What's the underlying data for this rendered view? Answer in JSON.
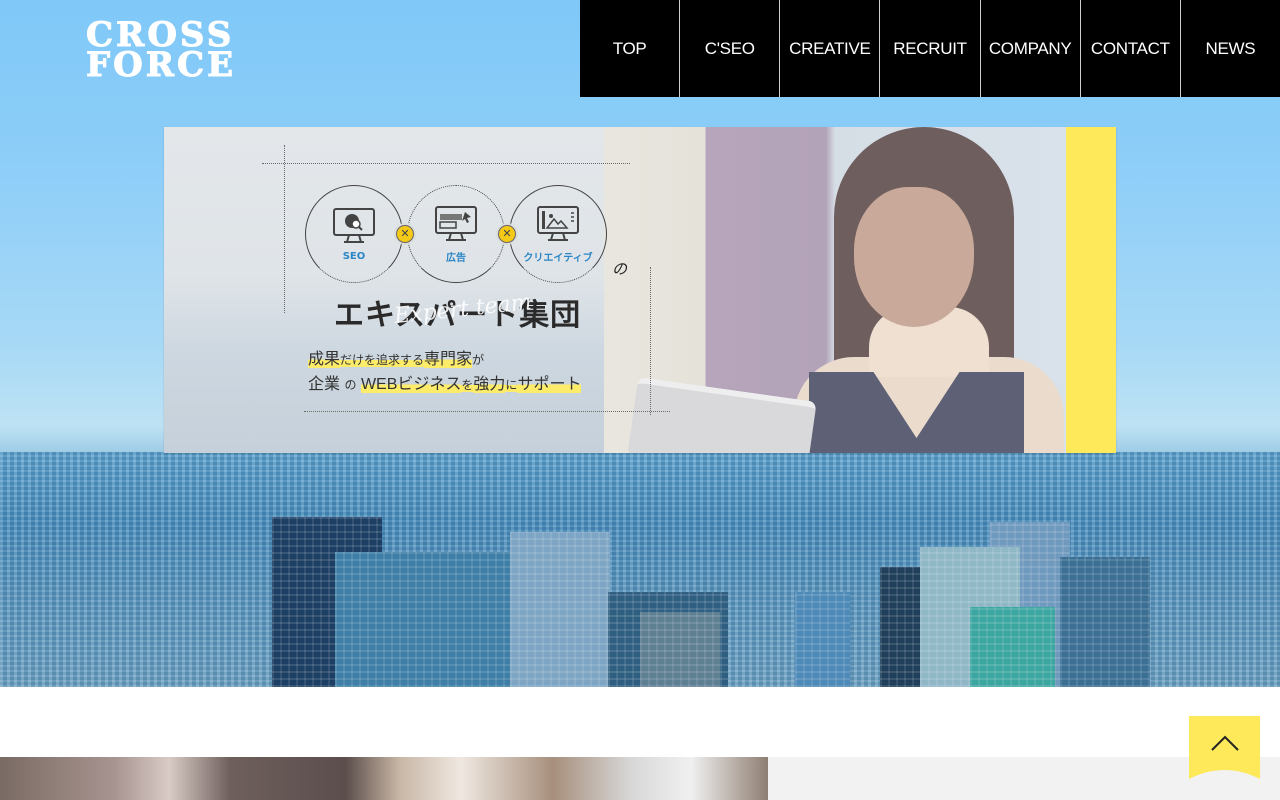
{
  "header": {
    "logo_line1": "CROSS",
    "logo_line2": "FORCE",
    "nav": [
      {
        "label": "TOP"
      },
      {
        "label": "C'SEO"
      },
      {
        "label": "CREATIVE"
      },
      {
        "label": "RECRUIT"
      },
      {
        "label": "COMPANY"
      },
      {
        "label": "CONTACT"
      },
      {
        "label": "NEWS"
      }
    ]
  },
  "hero": {
    "services": [
      {
        "label": "SEO",
        "icon": "seo-monitor-icon"
      },
      {
        "label": "広告",
        "icon": "ad-monitor-icon"
      },
      {
        "label": "クリエイティブ",
        "icon": "creative-monitor-icon"
      }
    ],
    "cross_symbol": "✕",
    "particle": "の",
    "headline": "エキスパート集団",
    "script_overlay": "Expert team",
    "tagline1": {
      "a": "成果",
      "b": "だけを",
      "c": "追求する",
      "d": "専門家",
      "e": "が"
    },
    "tagline2": {
      "a": "企業",
      "b": "の",
      "c": "WEBビジネス",
      "d": "を",
      "e": "強力",
      "f": "に",
      "g": "サポート"
    }
  },
  "back_to_top": {
    "icon": "chevron-up-icon"
  },
  "colors": {
    "nav_bg": "#000000",
    "accent_yellow": "#fde95a",
    "service_label": "#2a86c6",
    "sky": "#7fc8f8"
  }
}
